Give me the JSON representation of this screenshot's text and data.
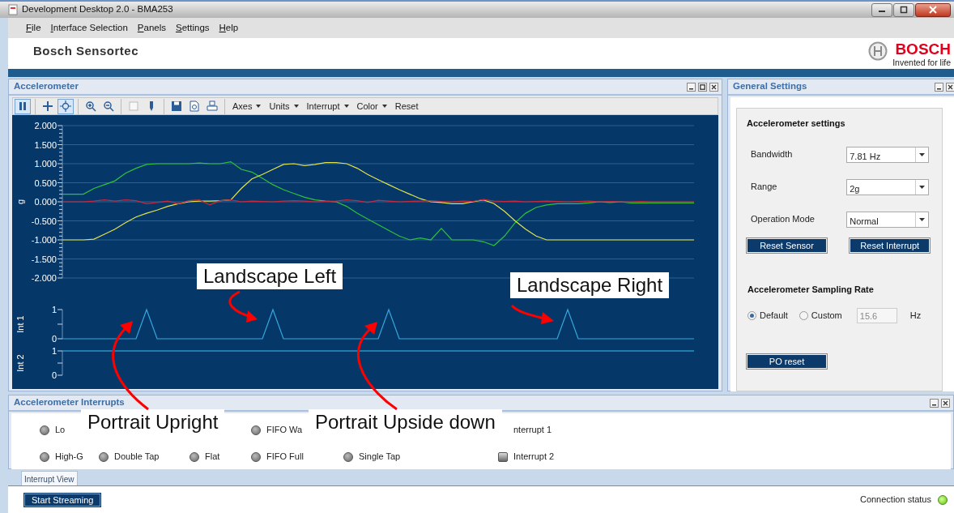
{
  "window": {
    "title": "Development Desktop 2.0 - BMA253"
  },
  "menu": [
    "File",
    "Interface Selection",
    "Panels",
    "Settings",
    "Help"
  ],
  "header": {
    "title": "Bosch Sensortec",
    "brand": "BOSCH",
    "tagline": "Invented for life"
  },
  "accelerometer_panel": {
    "title": "Accelerometer",
    "toolbar": [
      {
        "kind": "pause",
        "pressed": true
      },
      {
        "kind": "separator"
      },
      {
        "kind": "move",
        "pressed": false
      },
      {
        "kind": "target",
        "pressed": true
      },
      {
        "kind": "separator"
      },
      {
        "kind": "zoom-in",
        "pressed": false
      },
      {
        "kind": "zoom-out",
        "pressed": false
      },
      {
        "kind": "separator"
      },
      {
        "kind": "blank",
        "pressed": false
      },
      {
        "kind": "marker",
        "pressed": false
      },
      {
        "kind": "separator"
      },
      {
        "kind": "save",
        "pressed": false
      },
      {
        "kind": "preview",
        "pressed": false
      },
      {
        "kind": "print",
        "pressed": false
      },
      {
        "kind": "separator"
      }
    ],
    "menus": [
      "Axes",
      "Units",
      "Interrupt",
      "Color"
    ],
    "reset": "Reset",
    "charts": [
      {
        "chart_data": {
          "type": "line",
          "ylabel": "g",
          "ylim": [
            -2,
            2
          ],
          "grid": true,
          "yticks": [
            {
              "value": 2,
              "label": "2.000"
            },
            {
              "value": 1.5,
              "label": "1.500"
            },
            {
              "value": 1,
              "label": "1.000"
            },
            {
              "value": 0.5,
              "label": "0.500"
            },
            {
              "value": 0,
              "label": "0.000"
            },
            {
              "value": -0.5,
              "label": "-0.500"
            },
            {
              "value": -1,
              "label": "-1.000"
            },
            {
              "value": -1.5,
              "label": "-1.500"
            },
            {
              "value": -2,
              "label": "-2.000"
            }
          ],
          "categories": [
            null,
            null,
            null,
            null,
            null,
            null,
            null,
            null,
            null,
            null,
            null,
            null,
            null,
            null,
            null,
            null,
            null,
            null,
            null,
            null,
            null,
            null,
            null,
            null,
            null,
            null,
            null,
            null,
            null,
            null,
            null,
            null,
            null,
            null,
            null,
            null,
            null,
            null,
            null,
            null,
            null,
            null,
            null,
            null,
            null,
            null,
            null,
            null,
            null,
            null,
            null,
            null,
            null,
            null,
            null,
            null,
            null,
            null,
            null,
            null,
            null
          ],
          "series": [
            {
              "color": "#2ec23a",
              "values": [
                0.2,
                0.2,
                0.2,
                0.35,
                0.45,
                0.55,
                0.75,
                0.88,
                0.98,
                1.0,
                1.0,
                1.0,
                1.0,
                1.02,
                1.0,
                1.0,
                1.05,
                0.85,
                0.78,
                0.62,
                0.45,
                0.32,
                0.22,
                0.12,
                0.05,
                0.02,
                0.0,
                -0.12,
                -0.3,
                -0.45,
                -0.6,
                -0.75,
                -0.9,
                -1.0,
                -0.95,
                -1.0,
                -0.7,
                -1.0,
                -1.0,
                -1.0,
                -1.05,
                -1.15,
                -0.9,
                -0.55,
                -0.3,
                -0.15,
                -0.08,
                -0.05,
                -0.05,
                -0.05,
                -0.03,
                0.0,
                -0.02,
                0.0,
                -0.03,
                -0.03,
                -0.03,
                -0.03,
                -0.03,
                -0.03,
                -0.03
              ]
            },
            {
              "color": "#e2e24c",
              "values": [
                -1.0,
                -1.0,
                -1.0,
                -0.98,
                -0.85,
                -0.72,
                -0.55,
                -0.4,
                -0.3,
                -0.22,
                -0.12,
                -0.05,
                0.0,
                0.02,
                0.02,
                0.03,
                0.05,
                0.35,
                0.6,
                0.72,
                0.85,
                0.98,
                1.0,
                0.95,
                0.98,
                1.03,
                1.03,
                1.0,
                0.88,
                0.72,
                0.58,
                0.45,
                0.32,
                0.2,
                0.08,
                0.0,
                -0.02,
                -0.05,
                -0.05,
                0.0,
                0.05,
                -0.05,
                -0.25,
                -0.5,
                -0.72,
                -0.9,
                -1.0,
                -1.0,
                -1.0,
                -1.0,
                -1.0,
                -1.0,
                -1.0,
                -1.0,
                -1.0,
                -1.0,
                -1.0,
                -1.0,
                -1.0,
                -1.0,
                -1.0
              ]
            },
            {
              "color": "#c8283c",
              "values": [
                0,
                0,
                0,
                0.02,
                0.05,
                0.02,
                0.05,
                0.03,
                -0.05,
                -0.02,
                0.02,
                -0.05,
                0.03,
                0.05,
                -0.08,
                0.03,
                0.05,
                0,
                0.02,
                0.01,
                0,
                0.02,
                0.03,
                0.02,
                0,
                0.01,
                0.02,
                0.05,
                0.03,
                -0.02,
                0.04,
                0.02,
                0,
                0.01,
                0.02,
                0.03,
                0.01,
                0,
                0.02,
                0.01,
                0.06,
                0.02,
                0.01,
                0.02,
                0,
                0.01,
                0.02,
                0.01,
                0,
                0.01,
                0.02,
                0,
                0.01,
                0,
                0,
                0.01,
                0,
                0,
                0,
                0,
                0
              ]
            }
          ]
        }
      },
      {
        "chart_data": {
          "type": "line",
          "ylabel": "Int 1",
          "ylim": [
            0,
            1
          ],
          "yticks": [
            {
              "value": 0,
              "label": "0"
            },
            {
              "value": 1,
              "label": "1"
            }
          ],
          "categories": [
            null,
            null,
            null,
            null,
            null,
            null,
            null,
            null,
            null,
            null,
            null,
            null,
            null,
            null,
            null,
            null,
            null,
            null,
            null,
            null,
            null,
            null,
            null,
            null,
            null,
            null,
            null,
            null,
            null,
            null,
            null,
            null,
            null,
            null,
            null,
            null,
            null,
            null,
            null,
            null,
            null,
            null,
            null,
            null,
            null,
            null,
            null,
            null,
            null,
            null,
            null,
            null,
            null,
            null,
            null,
            null,
            null,
            null,
            null,
            null,
            null
          ],
          "series": [
            {
              "color": "#35a9dc",
              "values": [
                0,
                0,
                0,
                0,
                0,
                0,
                0,
                0,
                1,
                0,
                0,
                0,
                0,
                0,
                0,
                0,
                0,
                0,
                0,
                0,
                1,
                0,
                0,
                0,
                0,
                0,
                0,
                0,
                0,
                0,
                0,
                1,
                0,
                0,
                0,
                0,
                0,
                0,
                0,
                0,
                0,
                0,
                0,
                0,
                0,
                0,
                0,
                0,
                1,
                0,
                0,
                0,
                0,
                0,
                0,
                0,
                0,
                0,
                0,
                0,
                0
              ]
            }
          ]
        }
      },
      {
        "chart_data": {
          "type": "line",
          "ylabel": "Int 2",
          "ylim": [
            0,
            1
          ],
          "yticks": [
            {
              "value": 0,
              "label": "0"
            },
            {
              "value": 1,
              "label": "1"
            }
          ],
          "categories": [
            null,
            null,
            null,
            null,
            null,
            null,
            null,
            null,
            null,
            null,
            null,
            null,
            null,
            null,
            null,
            null,
            null,
            null,
            null,
            null,
            null,
            null,
            null,
            null,
            null,
            null,
            null,
            null,
            null,
            null,
            null,
            null,
            null,
            null,
            null,
            null,
            null,
            null,
            null,
            null,
            null,
            null,
            null,
            null,
            null,
            null,
            null,
            null,
            null,
            null,
            null,
            null,
            null,
            null,
            null,
            null,
            null,
            null,
            null,
            null,
            null
          ],
          "series": [
            {
              "color": "#3cc0ec",
              "values": [
                1,
                1,
                1,
                1,
                1,
                1,
                1,
                1,
                1,
                1,
                1,
                1,
                1,
                1,
                1,
                1,
                1,
                1,
                1,
                1,
                1,
                1,
                1,
                1,
                1,
                1,
                1,
                1,
                1,
                1,
                1,
                1,
                1,
                1,
                1,
                1,
                1,
                1,
                1,
                1,
                1,
                1,
                1,
                1,
                1,
                1,
                1,
                1,
                1,
                1,
                1,
                1,
                1,
                1,
                1,
                1,
                1,
                1,
                1,
                1,
                1
              ]
            }
          ]
        }
      }
    ]
  },
  "general_settings": {
    "title": "General Settings",
    "section": "Accelerometer settings",
    "fields": [
      {
        "label": "Bandwidth",
        "value": "7.81 Hz"
      },
      {
        "label": "Range",
        "value": "2g"
      },
      {
        "label": "Operation Mode",
        "value": "Normal"
      }
    ],
    "buttons": [
      "Reset Sensor",
      "Reset Interrupt"
    ],
    "sampling": {
      "title": "Accelerometer Sampling Rate",
      "options": [
        {
          "label": "Default",
          "selected": true
        },
        {
          "label": "Custom",
          "selected": false
        }
      ],
      "custom_value": "15.6",
      "custom_disabled": true,
      "unit": "Hz"
    },
    "po_reset": "PO reset"
  },
  "interrupts": {
    "title": "Accelerometer Interrupts",
    "rows": [
      [
        {
          "kind": "led",
          "label": "Lo",
          "on": false
        },
        {
          "kind": "empty"
        },
        {
          "kind": "empty"
        },
        {
          "kind": "led",
          "label": "FIFO Wa",
          "on": false
        },
        {
          "kind": "empty"
        },
        {
          "kind": "text",
          "label": "nterrupt 1"
        }
      ],
      [
        {
          "kind": "led",
          "label": "High-G",
          "on": false
        },
        {
          "kind": "led",
          "label": "Double Tap",
          "on": false
        },
        {
          "kind": "led",
          "label": "Flat",
          "on": false
        },
        {
          "kind": "led",
          "label": "FIFO Full",
          "on": false
        },
        {
          "kind": "led",
          "label": "Single Tap",
          "on": false
        },
        {
          "kind": "square",
          "label": "Interrupt 2",
          "on": false
        }
      ]
    ]
  },
  "tabs": [
    {
      "label": "Interrupt View",
      "selected": true
    }
  ],
  "status_bar": {
    "start_button": "Start Streaming",
    "connection": {
      "label": "Connection status",
      "connected": true
    }
  },
  "callouts": [
    {
      "text": "Landscape Left"
    },
    {
      "text": "Landscape Right"
    },
    {
      "text": "Portrait Upright"
    },
    {
      "text": "Portrait Upside down"
    }
  ]
}
